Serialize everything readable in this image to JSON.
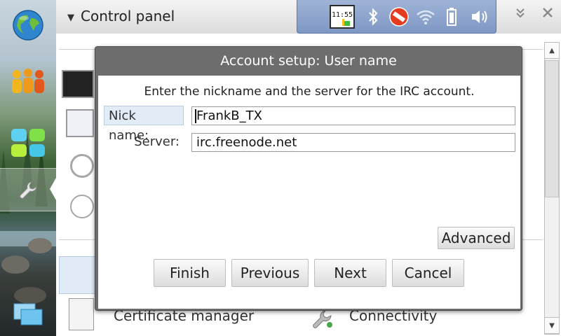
{
  "titlebar": {
    "title": "Control panel",
    "clock": "11:55"
  },
  "background_items": {
    "certificate_manager": "Certificate manager",
    "connectivity": "Connectivity"
  },
  "dialog": {
    "title": "Account setup: User name",
    "description": "Enter the nickname and the server for the IRC account.",
    "nick_label": "Nick name:",
    "nick_value": "FrankB_TX",
    "server_label": "Server:",
    "server_value": "irc.freenode.net",
    "advanced_label": "Advanced",
    "finish_label": "Finish",
    "previous_label": "Previous",
    "next_label": "Next",
    "cancel_label": "Cancel"
  },
  "colors": {
    "status_area": "#8aa2cc",
    "dialog_frame": "#6d6d6d",
    "field_highlight": "#e1ecf7"
  }
}
